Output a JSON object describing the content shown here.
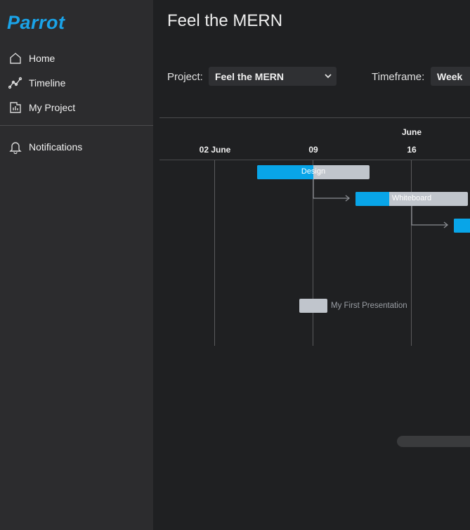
{
  "app": {
    "logo_text": "Parrot",
    "brand_color": "#1aa3e8"
  },
  "sidebar": {
    "items": [
      {
        "label": "Home",
        "icon": "home-icon"
      },
      {
        "label": "Timeline",
        "icon": "timeline-icon"
      },
      {
        "label": "My Project",
        "icon": "chart-icon"
      },
      {
        "label": "Notifications",
        "icon": "bell-icon"
      }
    ]
  },
  "page": {
    "title": "Feel the MERN"
  },
  "controls": {
    "project_label": "Project:",
    "project_value": "Feel the MERN",
    "timeframe_label": "Timeframe:",
    "timeframe_value": "Week"
  },
  "gantt": {
    "month_label": "June",
    "dates": [
      "02 June",
      "09",
      "16"
    ],
    "tasks": [
      {
        "name": "Design",
        "progress": 0.5
      },
      {
        "name": "Whiteboard",
        "progress": 0.3
      },
      {
        "name": "",
        "progress": 1.0
      },
      {
        "name": "My First Presentation",
        "progress": 0
      }
    ],
    "colors": {
      "progress": "#08a5e8",
      "remaining": "#c0c5cc"
    }
  }
}
